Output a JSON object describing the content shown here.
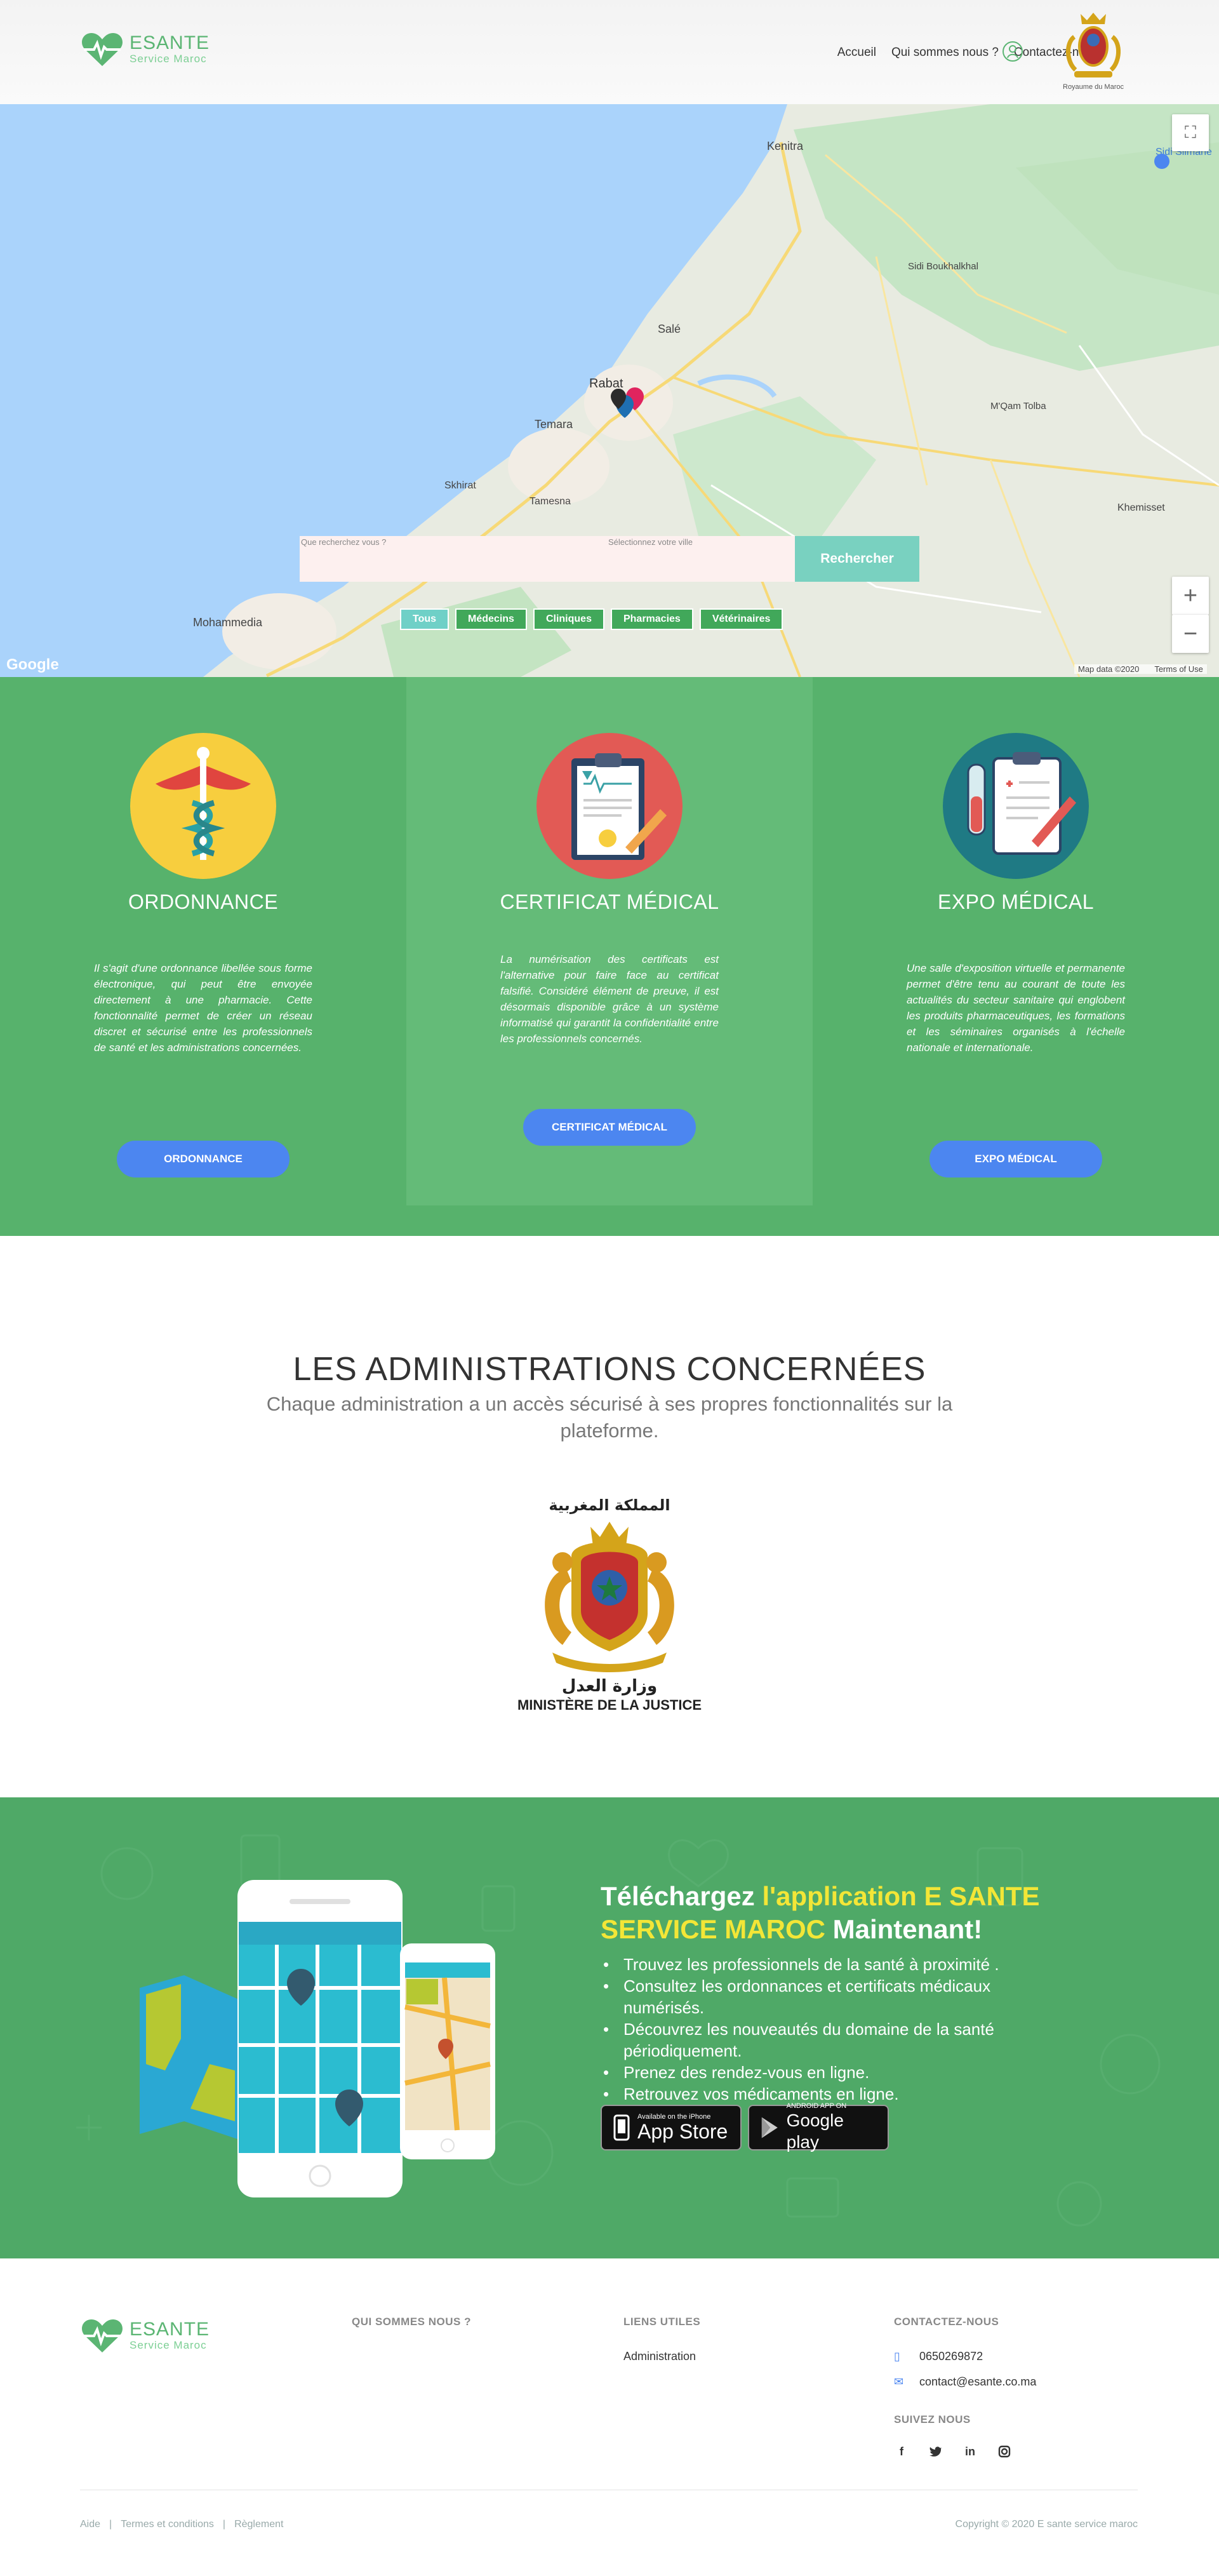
{
  "brand": {
    "name": "ESANTE",
    "tagline": "Service Maroc",
    "color": "#5bb573"
  },
  "nav": {
    "items": [
      "Accueil",
      "Qui sommes nous ?",
      "Contactez-nous"
    ]
  },
  "header": {
    "crest_caption": "Royaume du Maroc"
  },
  "map": {
    "attribution": "Map data ©2020",
    "terms": "Terms of Use",
    "provider": "Google"
  },
  "search": {
    "placeholder_what": "Que recherchez vous ?",
    "placeholder_city": "Sélectionnez votre ville",
    "button": "Rechercher"
  },
  "filters": [
    "Tous",
    "Médecins",
    "Cliniques",
    "Pharmacies",
    "Vétérinaires"
  ],
  "services": [
    {
      "title": "ORDONNANCE",
      "text": "Il s'agit d'une ordonnance libellée sous forme électronique, qui peut être envoyée directement à une pharmacie. Cette fonctionnalité permet de créer un réseau discret et sécurisé entre les professionnels de santé et les administrations concernées.",
      "button": "ORDONNANCE",
      "icon": "caduceus-icon"
    },
    {
      "title": "CERTIFICAT MÉDICAL",
      "text": "La numérisation des certificats est l'alternative pour faire face au certificat falsifié. Considéré élément de preuve, il est désormais disponible grâce à un système informatisé qui garantit la confidentialité entre les professionnels concernés.",
      "button": "CERTIFICAT MÉDICAL",
      "icon": "clipboard-icon"
    },
    {
      "title": "EXPO MÉDICAL",
      "text": "Une salle d'exposition virtuelle et permanente permet d'être tenu au courant de toute les actualités du secteur sanitaire qui englobent les produits pharmaceutiques, les formations et les séminaires organisés à l'échelle nationale et internationale.",
      "button": "EXPO MÉDICAL",
      "icon": "lab-report-icon"
    }
  ],
  "admin": {
    "title": "LES ADMINISTRATIONS CONCERNÉES",
    "subtitle": "Chaque administration a un accès sécurisé à ses propres fonctionnalités sur la plateforme.",
    "ministry_ar_top": "المملكة المغربية",
    "ministry_ar": "وزارة العدل",
    "ministry_fr": "MINISTÈRE DE LA JUSTICE"
  },
  "app": {
    "title_pre": "Téléchargez ",
    "title_hl": "l'application E SANTE SERVICE MAROC",
    "title_post": " Maintenant!",
    "features": [
      "Trouvez les professionnels de la santé à proximité .",
      "Consultez les ordonnances et certificats médicaux numérisés.",
      "Découvrez les nouveautés du domaine de la santé périodiquement.",
      "Prenez des rendez-vous en ligne.",
      "Retrouvez vos médicaments en ligne."
    ],
    "appstore_small": "Available on the iPhone",
    "appstore_big": "App Store",
    "play_small": "ANDROID APP ON",
    "play_big": "Google play"
  },
  "footer": {
    "col_about": "QUI SOMMES NOUS ?",
    "col_links": "LIENS UTILES",
    "link_admin": "Administration",
    "col_contact": "CONTACTEZ-NOUS",
    "phone": "0650269872",
    "email": "contact@esante.co.ma",
    "follow": "SUIVEZ NOUS",
    "bottom_links": [
      "Aide",
      "|",
      "Termes et conditions",
      "|",
      "Règlement"
    ],
    "copyright": "Copyright © 2020 E sante service maroc"
  },
  "colors": {
    "green": "#57b26c",
    "green_mid": "#64bb78",
    "app_green": "#4fa967",
    "button_blue": "#4c86f0",
    "teal": "#79d1c0",
    "yellow": "#f3e637"
  }
}
